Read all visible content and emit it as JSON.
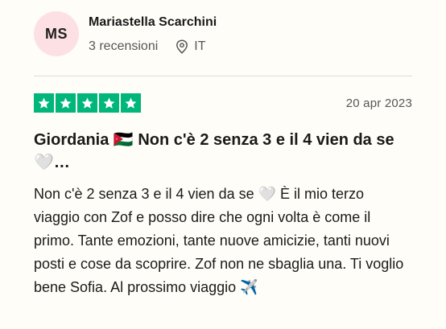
{
  "reviewer": {
    "initials": "MS",
    "name": "Mariastella Scarchini",
    "reviews_count": "3 recensioni",
    "country": "IT",
    "avatar_color": "#fde0e4"
  },
  "review": {
    "rating": 5,
    "max_rating": 5,
    "star_color": "#00b67a",
    "date": "20 apr 2023",
    "title": "Giordania 🇯🇴 Non c'è 2 senza 3 e il 4 vien da se 🤍…",
    "body": "Non c'è 2 senza 3 e il 4 vien da se 🤍 È il mio terzo viaggio con Zof e posso dire che ogni volta è come il primo. Tante emozioni, tante nuove amicizie, tanti nuovi posti e cose da scoprire. Zof non ne sbaglia una. Ti voglio bene Sofia. Al prossimo viaggio ✈️"
  },
  "icons": {
    "location": "location-pin-icon",
    "star": "star-icon"
  }
}
